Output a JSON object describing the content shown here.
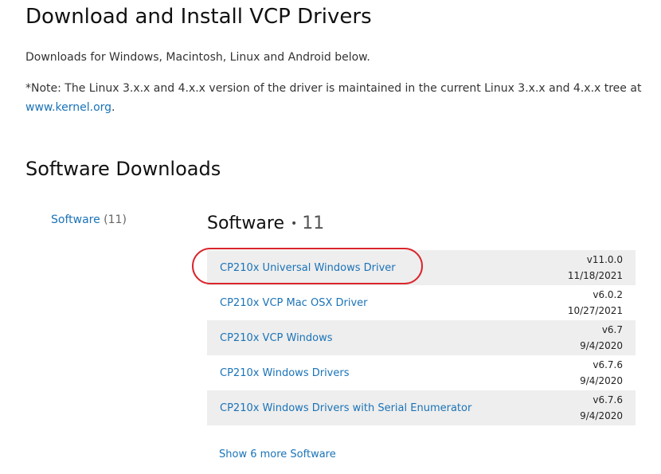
{
  "page": {
    "title": "Download and Install VCP Drivers",
    "intro": "Downloads for Windows, Macintosh, Linux and Android below.",
    "note_text": "*Note: The Linux 3.x.x and 4.x.x version of the driver is maintained in the current Linux 3.x.x and 4.x.x tree at ",
    "note_link": "www.kernel.org",
    "note_end": "."
  },
  "downloads": {
    "section_title": "Software Downloads",
    "filter": {
      "label": "Software",
      "count": "(11)"
    },
    "list_header": {
      "label": "Software",
      "separator": "•",
      "count": "11"
    },
    "items": [
      {
        "title": "CP210x Universal Windows Driver",
        "version": "v11.0.0",
        "date": "11/18/2021"
      },
      {
        "title": "CP210x VCP Mac OSX Driver",
        "version": "v6.0.2",
        "date": "10/27/2021"
      },
      {
        "title": "CP210x VCP Windows",
        "version": "v6.7",
        "date": "9/4/2020"
      },
      {
        "title": "CP210x Windows Drivers",
        "version": "v6.7.6",
        "date": "9/4/2020"
      },
      {
        "title": "CP210x Windows Drivers with Serial Enumerator",
        "version": "v6.7.6",
        "date": "9/4/2020"
      }
    ],
    "show_more": "Show 6 more Software"
  },
  "colors": {
    "link": "#1a73b8",
    "row_shade": "#eeeeee",
    "highlight": "#d9262c"
  }
}
